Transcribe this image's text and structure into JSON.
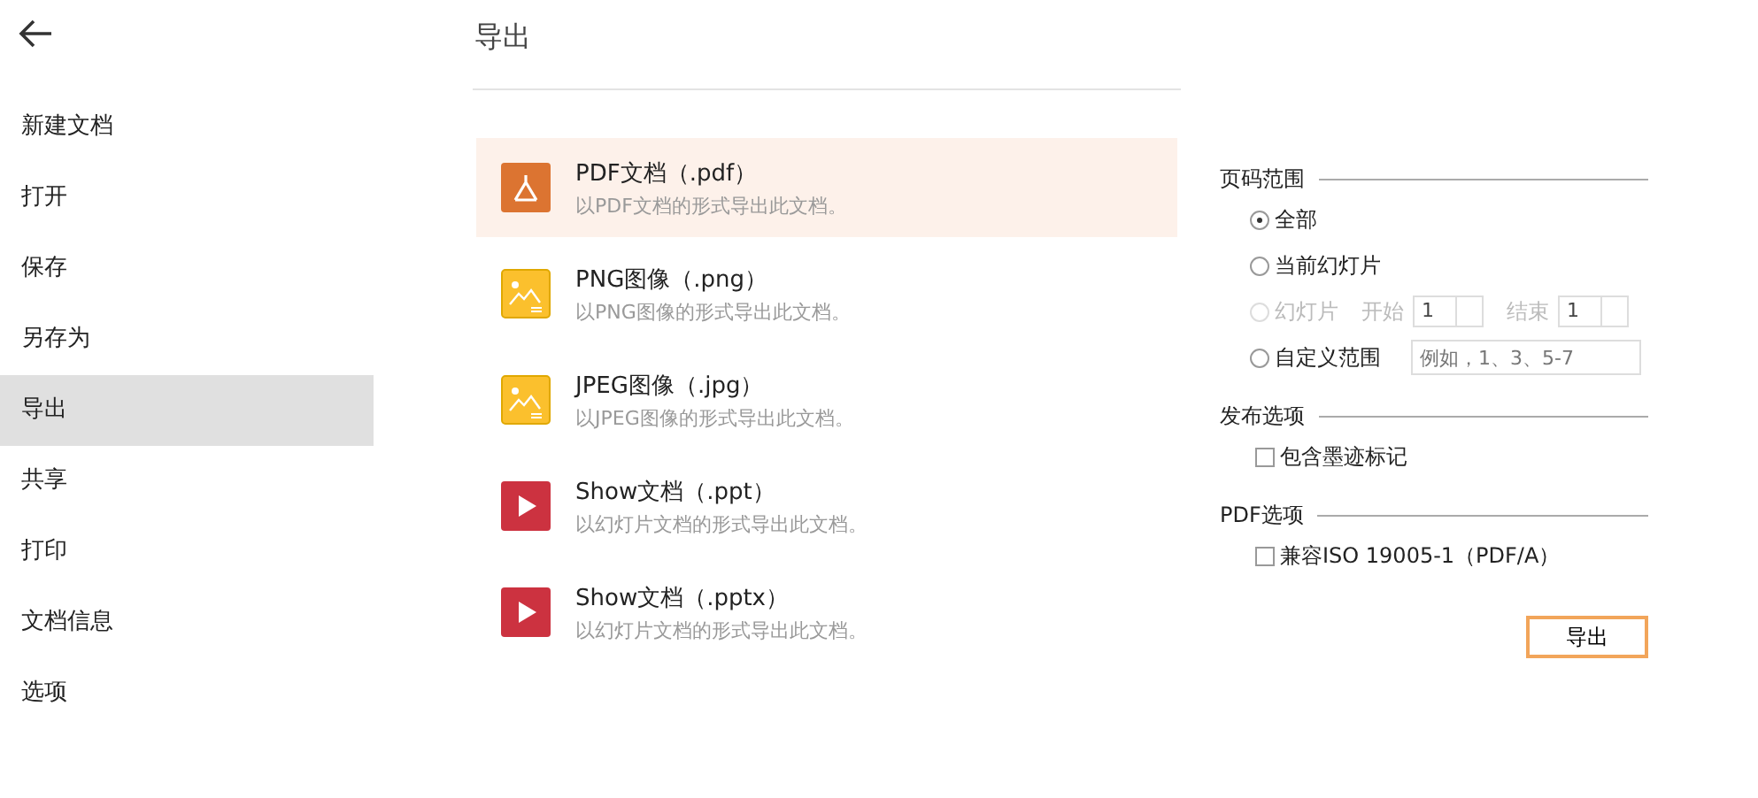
{
  "sidebar": {
    "items": [
      {
        "label": "新建文档",
        "selected": false
      },
      {
        "label": "打开",
        "selected": false
      },
      {
        "label": "保存",
        "selected": false
      },
      {
        "label": "另存为",
        "selected": false
      },
      {
        "label": "导出",
        "selected": true
      },
      {
        "label": "共享",
        "selected": false
      },
      {
        "label": "打印",
        "selected": false
      },
      {
        "label": "文档信息",
        "selected": false
      },
      {
        "label": "选项",
        "selected": false
      }
    ]
  },
  "title": "导出",
  "formats": [
    {
      "kind": "pdf",
      "name": "PDF文档（.pdf）",
      "description": "以PDF文档的形式导出此文档。",
      "selected": true
    },
    {
      "kind": "image",
      "name": "PNG图像（.png）",
      "description": "以PNG图像的形式导出此文档。",
      "selected": false
    },
    {
      "kind": "image",
      "name": "JPEG图像（.jpg）",
      "description": "以JPEG图像的形式导出此文档。",
      "selected": false
    },
    {
      "kind": "slides",
      "name": "Show文档（.ppt）",
      "description": "以幻灯片文档的形式导出此文档。",
      "selected": false
    },
    {
      "kind": "slides",
      "name": "Show文档（.pptx）",
      "description": "以幻灯片文档的形式导出此文档。",
      "selected": false
    }
  ],
  "page_range": {
    "title": "页码范围",
    "options": [
      {
        "kind": "plain",
        "label": "全部",
        "selected": true,
        "disabled": false
      },
      {
        "kind": "plain",
        "label": "当前幻灯片",
        "selected": false,
        "disabled": false
      },
      {
        "kind": "range",
        "label": "幻灯片",
        "selected": false,
        "disabled": true,
        "start_label": "开始",
        "start_value": "1",
        "end_label": "结束",
        "end_value": "1"
      },
      {
        "kind": "custom",
        "label": "自定义范围",
        "selected": false,
        "disabled": false,
        "placeholder": "例如，1、3、5-7"
      }
    ]
  },
  "publish_options": {
    "title": "发布选项",
    "checkboxes": [
      {
        "label": "包含墨迹标记",
        "checked": false
      }
    ]
  },
  "pdf_options": {
    "title": "PDF选项",
    "checkboxes": [
      {
        "label": "兼容ISO 19005-1（PDF/A）",
        "checked": false
      }
    ]
  },
  "export_button": "导出"
}
